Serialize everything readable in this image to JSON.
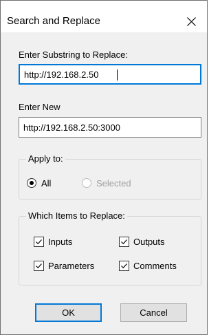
{
  "dialog": {
    "title": "Search and Replace",
    "close_icon": "close-icon"
  },
  "substring": {
    "label": "Enter Substring to Replace:",
    "value": "http://192.168.2.50"
  },
  "replacement": {
    "label": "Enter New",
    "value": "http://192.168.2.50:3000"
  },
  "apply_to": {
    "legend": "Apply to:",
    "options": [
      {
        "label": "All",
        "checked": true,
        "enabled": true
      },
      {
        "label": "Selected",
        "checked": false,
        "enabled": false
      }
    ]
  },
  "items": {
    "legend": "Which Items to Replace:",
    "checkboxes": [
      {
        "label": "Inputs",
        "checked": true
      },
      {
        "label": "Outputs",
        "checked": true
      },
      {
        "label": "Parameters",
        "checked": true
      },
      {
        "label": "Comments",
        "checked": true
      }
    ]
  },
  "buttons": {
    "ok": "OK",
    "cancel": "Cancel"
  },
  "colors": {
    "focus_accent": "#0078d7",
    "dialog_background": "#f0f0f0",
    "disabled_text": "#a0a0a0"
  }
}
